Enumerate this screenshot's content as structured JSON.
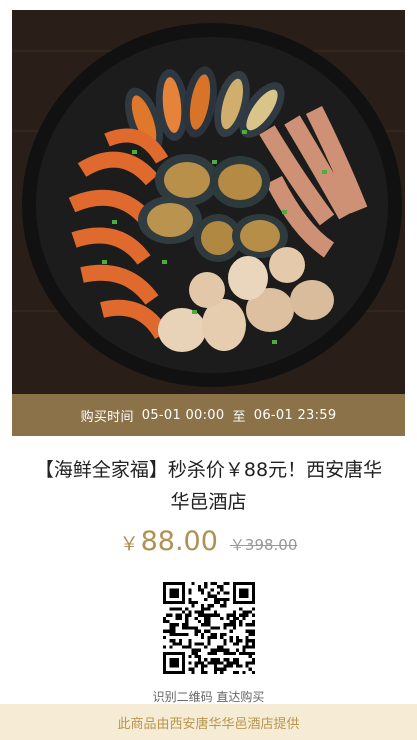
{
  "banner": {
    "label": "购买时间",
    "start": "05-01 00:00",
    "connector": "至",
    "end": "06-01 23:59"
  },
  "product": {
    "title": "【海鲜全家福】秒杀价￥88元！西安唐华华邑酒店"
  },
  "pricing": {
    "currency": "￥",
    "current": "88.00",
    "original": "￥398.00"
  },
  "qr": {
    "caption": "识别二维码 直达购买"
  },
  "footer": {
    "text": "此商品由西安唐华华邑酒店提供"
  },
  "colors": {
    "accent": "#8b7249",
    "price": "#b09155",
    "footer_bg": "#f6ecd5"
  }
}
